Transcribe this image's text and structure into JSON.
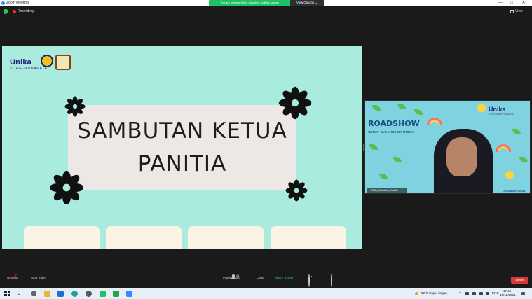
{
  "window": {
    "title": "Zoom Meeting",
    "minimize": "—",
    "maximize": "□",
    "close": "✕"
  },
  "share_banner": {
    "text": "You are viewing SMU_Adsabel_Judith's screen",
    "view_options": "View Options ⌄"
  },
  "status": {
    "recording": "Recording",
    "view": "View"
  },
  "slide": {
    "brand": "Unika",
    "brand_sub": "SOEGIJAPRANATA",
    "title_line1": "SAMBUTAN KETUA",
    "title_line2": "PANITIA"
  },
  "video": {
    "heading": "ROADSHOW",
    "subheading": "SENAT MAHASISWA UNIKA",
    "brand": "Unika",
    "brand_sub": "SOEGIJAPRANATA",
    "date": "DESEMBER 2021",
    "name_tag": "SMU_Adsabel_Judith"
  },
  "toolbar": {
    "unmute": "Unmute",
    "stop_video": "Stop Video",
    "participants": "Participants",
    "participants_count": "41",
    "chat": "Chat",
    "share_screen": "Share Screen",
    "record": "Record",
    "reactions": "Reactions",
    "leave": "Leave",
    "caret": "^"
  },
  "taskbar": {
    "weather": "32°C  Hujan ringan",
    "chevron": "^",
    "language": "ENG",
    "time": "17:41",
    "date": "10/12/2021",
    "search_glyph": "⌕"
  },
  "colors": {
    "slide_bg": "#a9ecdf",
    "title_box": "#ede7e6",
    "share_green": "#20c163",
    "leave_red": "#d93838"
  }
}
